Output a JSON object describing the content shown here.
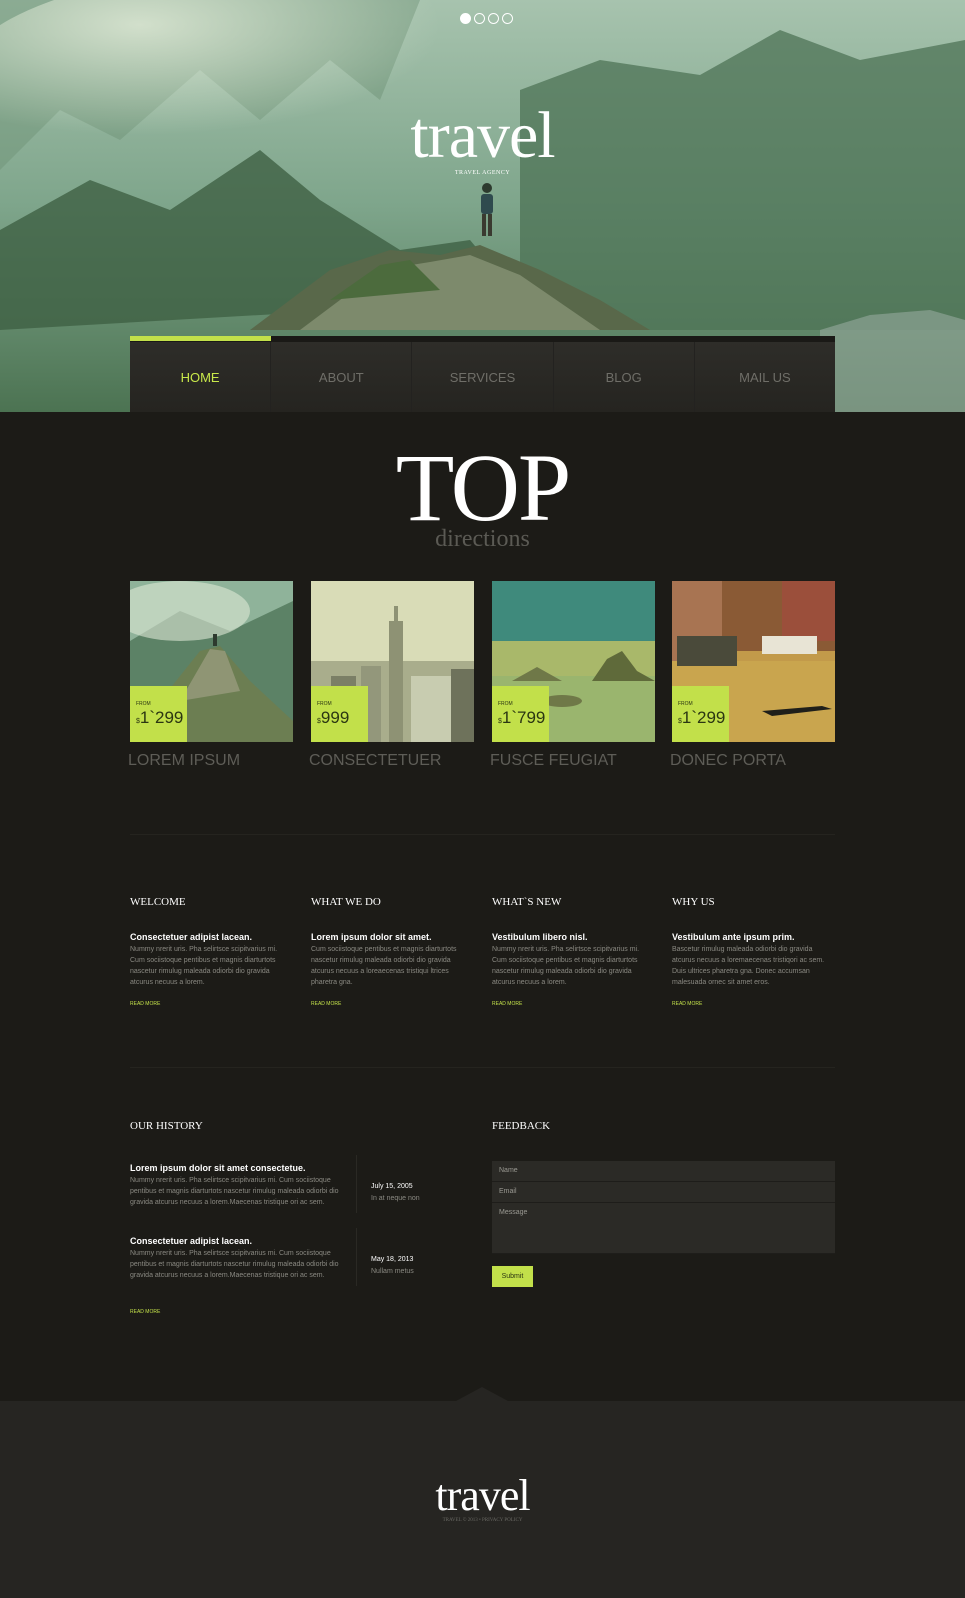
{
  "hero": {
    "logo": "travel",
    "tagline": "TRAVEL AGENCY",
    "slides": 4,
    "active_slide": 1
  },
  "nav": {
    "items": [
      {
        "label": "HOME",
        "active": true
      },
      {
        "label": "ABOUT",
        "active": false
      },
      {
        "label": "SERVICES",
        "active": false
      },
      {
        "label": "BLOG",
        "active": false
      },
      {
        "label": "MAIL US",
        "active": false
      }
    ]
  },
  "top": {
    "title": "TOP",
    "subtitle": "directions"
  },
  "directions": [
    {
      "name": "LOREM IPSUM",
      "from": "FROM",
      "price": "1`299",
      "currency": "$",
      "image": "mountain-hiker"
    },
    {
      "name": "CONSECTETUER",
      "from": "FROM",
      "price": "999",
      "currency": "$",
      "image": "city-skyline"
    },
    {
      "name": "FUSCE FEUGIAT",
      "from": "FROM",
      "price": "1`799",
      "currency": "$",
      "image": "bay-mountain"
    },
    {
      "name": "DONEC PORTA",
      "from": "FROM",
      "price": "1`299",
      "currency": "$",
      "image": "venice-canal"
    }
  ],
  "features": [
    {
      "title": "WELCOME",
      "heading": "Consectetuer adipist lacean.",
      "text": "Nummy nrerit uris. Pha selirtsce scipitvarius mi. Cum sociistoque pentibus et magnis diarturtots nascetur rimulug maleada odiorbi dio gravida atcurus necuus a lorem.",
      "more": "READ MORE"
    },
    {
      "title": "WHAT WE DO",
      "heading": "Lorem ipsum dolor sit amet.",
      "text": "Cum sociistoque pentibus et magnis diarturtots nascetur rimulug maleada odiorbi dio gravida atcurus necuus a loreaecenas tristiqui ltrices pharetra gna.",
      "more": "READ MORE"
    },
    {
      "title": "WHAT`S NEW",
      "heading": "Vestibulum libero nisl.",
      "text": "Nummy nrerit uris. Pha selirtsce scipitvarius mi. Cum sociistoque pentibus et magnis diarturtots nascetur rimulug maleada odiorbi dio gravida atcurus necuus a lorem.",
      "more": "READ MORE"
    },
    {
      "title": "WHY US",
      "heading": "Vestibulum ante ipsum prim.",
      "text": "Bascetur rimulug maleada odiorbi dio gravida atcurus necuus a loremaecenas tristiqori ac sem. Duis ultrices pharetra gna. Donec accumsan malesuada ornec sit amet eros.",
      "more": "READ MORE"
    }
  ],
  "history": {
    "title": "OUR HISTORY",
    "entries": [
      {
        "heading": "Lorem ipsum dolor sit amet consectetue.",
        "text": "Nummy nrerit uris. Pha selirtsce scipitvarius mi. Cum sociistoque pentibus et magnis diarturtots nascetur rimulug maleada odiorbi dio gravida atcurus necuus a lorem.Maecenas tristique ori ac sem.",
        "date": "July 15, 2005",
        "note": "In at neque non"
      },
      {
        "heading": "Consectetuer adipist lacean.",
        "text": "Nummy nrerit uris. Pha selirtsce scipitvarius mi. Cum sociistoque pentibus et magnis diarturtots nascetur rimulug maleada odiorbi dio gravida atcurus necuus a lorem.Maecenas tristique ori ac sem.",
        "date": "May 18, 2013",
        "note": "Nullam metus"
      }
    ],
    "more": "READ MORE"
  },
  "feedback": {
    "title": "FEEDBACK",
    "name_placeholder": "Name",
    "email_placeholder": "Email",
    "message_placeholder": "Message",
    "submit": "Submit"
  },
  "footer": {
    "logo": "travel",
    "copyright": "TRAVEL © 2013 • PRIVACY POLICY"
  },
  "colors": {
    "accent": "#c2e04a",
    "background": "#1c1b17",
    "footer": "#262522"
  }
}
